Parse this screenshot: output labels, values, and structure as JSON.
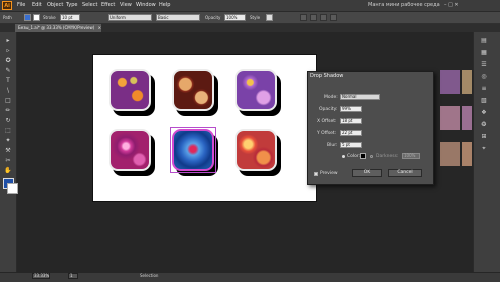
{
  "menubar": {
    "logo": "Ai",
    "items": [
      "File",
      "Edit",
      "Object",
      "Type",
      "Select",
      "Effect",
      "View",
      "Window",
      "Help"
    ],
    "window_title": "Манга мини рабочее среда",
    "window_buttons": "–  □  ✕"
  },
  "controlbar": {
    "path_label": "Path",
    "stroke_label": "Stroke",
    "stroke_value": "10 pt",
    "profile_value": "Uniform",
    "brush_value": "Basic",
    "opacity_label": "Opacity",
    "opacity_value": "100%",
    "style_label": "Style"
  },
  "document": {
    "tab_label": "Безы_1.ai* @ 33.33% (CMYK/Preview)",
    "tab_close": "×"
  },
  "tools": [
    "▸",
    "▹",
    "✪",
    "✎",
    "T",
    "\\",
    "□",
    "✏",
    "↻",
    "⬚",
    "✦",
    "⚒",
    "✂",
    "✋",
    "🔍"
  ],
  "right_tools": [
    "▤",
    "▦",
    "☰",
    "◎",
    "≡",
    "▧",
    "❖",
    "❂",
    "⊞",
    "⌖"
  ],
  "dialog": {
    "title": "Drop Shadow",
    "mode_label": "Mode:",
    "mode_value": "Normal",
    "opacity_label": "Opacity:",
    "opacity_value": "99%",
    "xoffset_label": "X Offset:",
    "xoffset_value": "18 pt",
    "yoffset_label": "Y Offset:",
    "yoffset_value": "22 pt",
    "blur_label": "Blur:",
    "blur_value": "5 pt",
    "color_label": "Color:",
    "darkness_label": "Darkness:",
    "darkness_value": "100%",
    "preview_label": "Preview",
    "ok_label": "OK",
    "cancel_label": "Cancel"
  },
  "status": {
    "zoom_value": "33.33%",
    "page_value": "1",
    "tool_name": "Selection"
  }
}
